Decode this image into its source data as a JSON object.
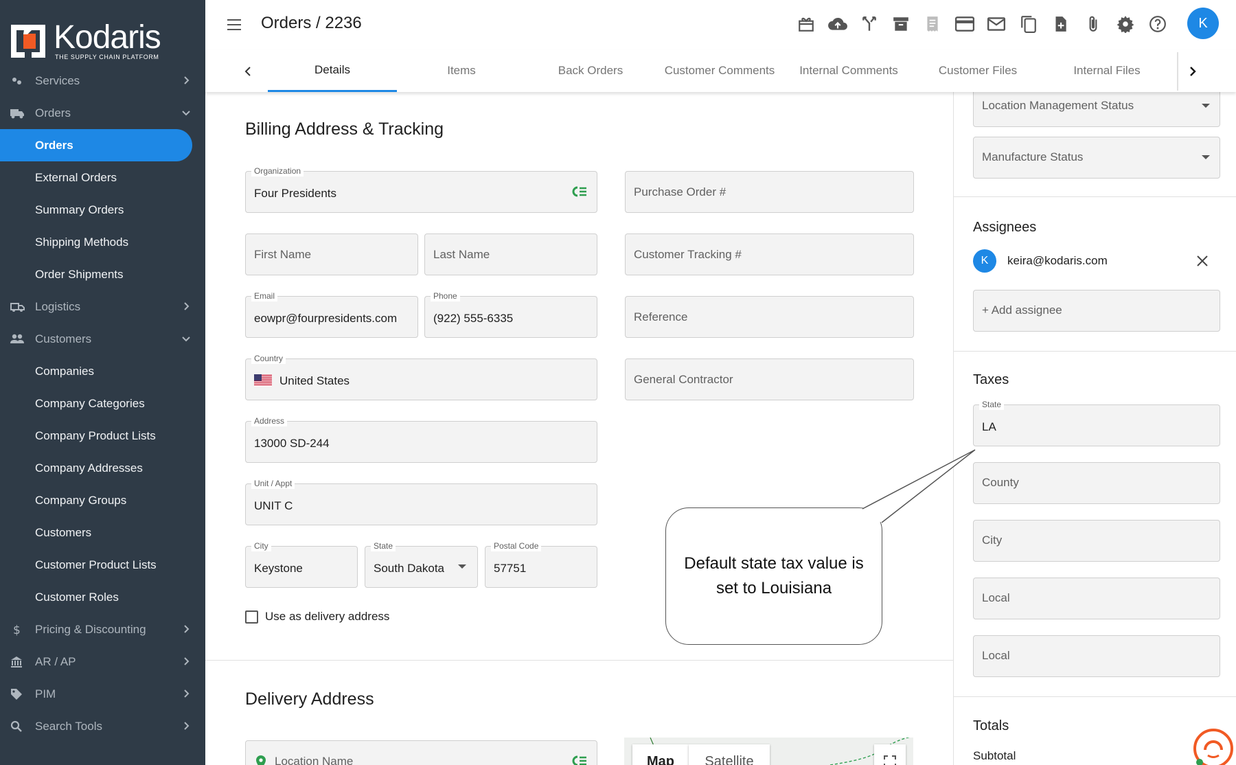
{
  "app": {
    "brand": "Kodaris",
    "tagline": "THE SUPPLY CHAIN PLATFORM"
  },
  "header": {
    "title": "Orders / 2236",
    "avatar_letter": "K"
  },
  "toolbar_icons": [
    "gift-icon",
    "cloud-upload-icon",
    "merge-icon",
    "archive-icon",
    "receipt-icon",
    "credit-card-icon",
    "mail-icon",
    "copy-icon",
    "add-file-icon",
    "paperclip-icon",
    "settings-icon",
    "help-icon"
  ],
  "sidebar": {
    "items": [
      {
        "label": "Services",
        "type": "group",
        "icon": "services-icon",
        "state": "collapsed"
      },
      {
        "label": "Orders",
        "type": "group",
        "icon": "truck-icon",
        "state": "expanded"
      },
      {
        "label": "Orders",
        "type": "sub",
        "active": true
      },
      {
        "label": "External Orders",
        "type": "sub"
      },
      {
        "label": "Summary Orders",
        "type": "sub"
      },
      {
        "label": "Shipping Methods",
        "type": "sub"
      },
      {
        "label": "Order Shipments",
        "type": "sub"
      },
      {
        "label": "Logistics",
        "type": "group",
        "icon": "logistics-icon",
        "state": "collapsed"
      },
      {
        "label": "Customers",
        "type": "group",
        "icon": "people-icon",
        "state": "expanded"
      },
      {
        "label": "Companies",
        "type": "sub"
      },
      {
        "label": "Company Categories",
        "type": "sub"
      },
      {
        "label": "Company Product Lists",
        "type": "sub"
      },
      {
        "label": "Company Addresses",
        "type": "sub"
      },
      {
        "label": "Company Groups",
        "type": "sub"
      },
      {
        "label": "Customers",
        "type": "sub"
      },
      {
        "label": "Customer Product Lists",
        "type": "sub"
      },
      {
        "label": "Customer Roles",
        "type": "sub"
      },
      {
        "label": "Pricing & Discounting",
        "type": "group",
        "icon": "dollar-icon",
        "state": "collapsed"
      },
      {
        "label": "AR / AP",
        "type": "group",
        "icon": "bank-icon",
        "state": "collapsed"
      },
      {
        "label": "PIM",
        "type": "group",
        "icon": "tag-icon",
        "state": "collapsed"
      },
      {
        "label": "Search Tools",
        "type": "group",
        "icon": "search-icon",
        "state": "collapsed"
      }
    ]
  },
  "tabs": [
    {
      "label": "Details",
      "active": true
    },
    {
      "label": "Items"
    },
    {
      "label": "Back Orders"
    },
    {
      "label": "Customer Comments"
    },
    {
      "label": "Internal Comments"
    },
    {
      "label": "Customer Files"
    },
    {
      "label": "Internal Files"
    }
  ],
  "billing": {
    "title": "Billing Address & Tracking",
    "organization": {
      "label": "Organization",
      "value": "Four Presidents"
    },
    "purchase_order": {
      "placeholder": "Purchase Order #"
    },
    "first_name": {
      "placeholder": "First Name"
    },
    "last_name": {
      "placeholder": "Last Name"
    },
    "customer_tracking": {
      "placeholder": "Customer Tracking #"
    },
    "email": {
      "label": "Email",
      "value": "eowpr@fourpresidents.com"
    },
    "phone": {
      "label": "Phone",
      "value": "(922) 555-6335"
    },
    "reference": {
      "placeholder": "Reference"
    },
    "country": {
      "label": "Country",
      "value": "United States"
    },
    "general_contractor": {
      "placeholder": "General Contractor"
    },
    "address": {
      "label": "Address",
      "value": "13000 SD-244"
    },
    "unit": {
      "label": "Unit / Appt",
      "value": "UNIT C"
    },
    "city": {
      "label": "City",
      "value": "Keystone"
    },
    "state": {
      "label": "State",
      "value": "South Dakota"
    },
    "postal": {
      "label": "Postal Code",
      "value": "57751"
    },
    "use_delivery": {
      "label": "Use as delivery address",
      "checked": false
    }
  },
  "delivery": {
    "title": "Delivery Address",
    "location_name": {
      "placeholder": "Location Name"
    },
    "map_tabs": [
      "Map",
      "Satellite"
    ]
  },
  "right_panel": {
    "location_status": {
      "placeholder": "Location Management Status"
    },
    "manufacture_status": {
      "placeholder": "Manufacture Status"
    },
    "assignees_title": "Assignees",
    "assignee": {
      "letter": "K",
      "email": "keira@kodaris.com"
    },
    "add_assignee": "+ Add assignee",
    "taxes_title": "Taxes",
    "tax_state": {
      "label": "State",
      "value": "LA"
    },
    "county": {
      "placeholder": "County"
    },
    "city": {
      "placeholder": "City"
    },
    "local1": {
      "placeholder": "Local"
    },
    "local2": {
      "placeholder": "Local"
    },
    "totals_title": "Totals",
    "subtotal_label": "Subtotal"
  },
  "callout": {
    "text": "Default state tax value  is set to Louisiana"
  },
  "colors": {
    "accent": "#1e88e5",
    "sidebar": "#2f3b47",
    "green": "#2e9e4f"
  }
}
